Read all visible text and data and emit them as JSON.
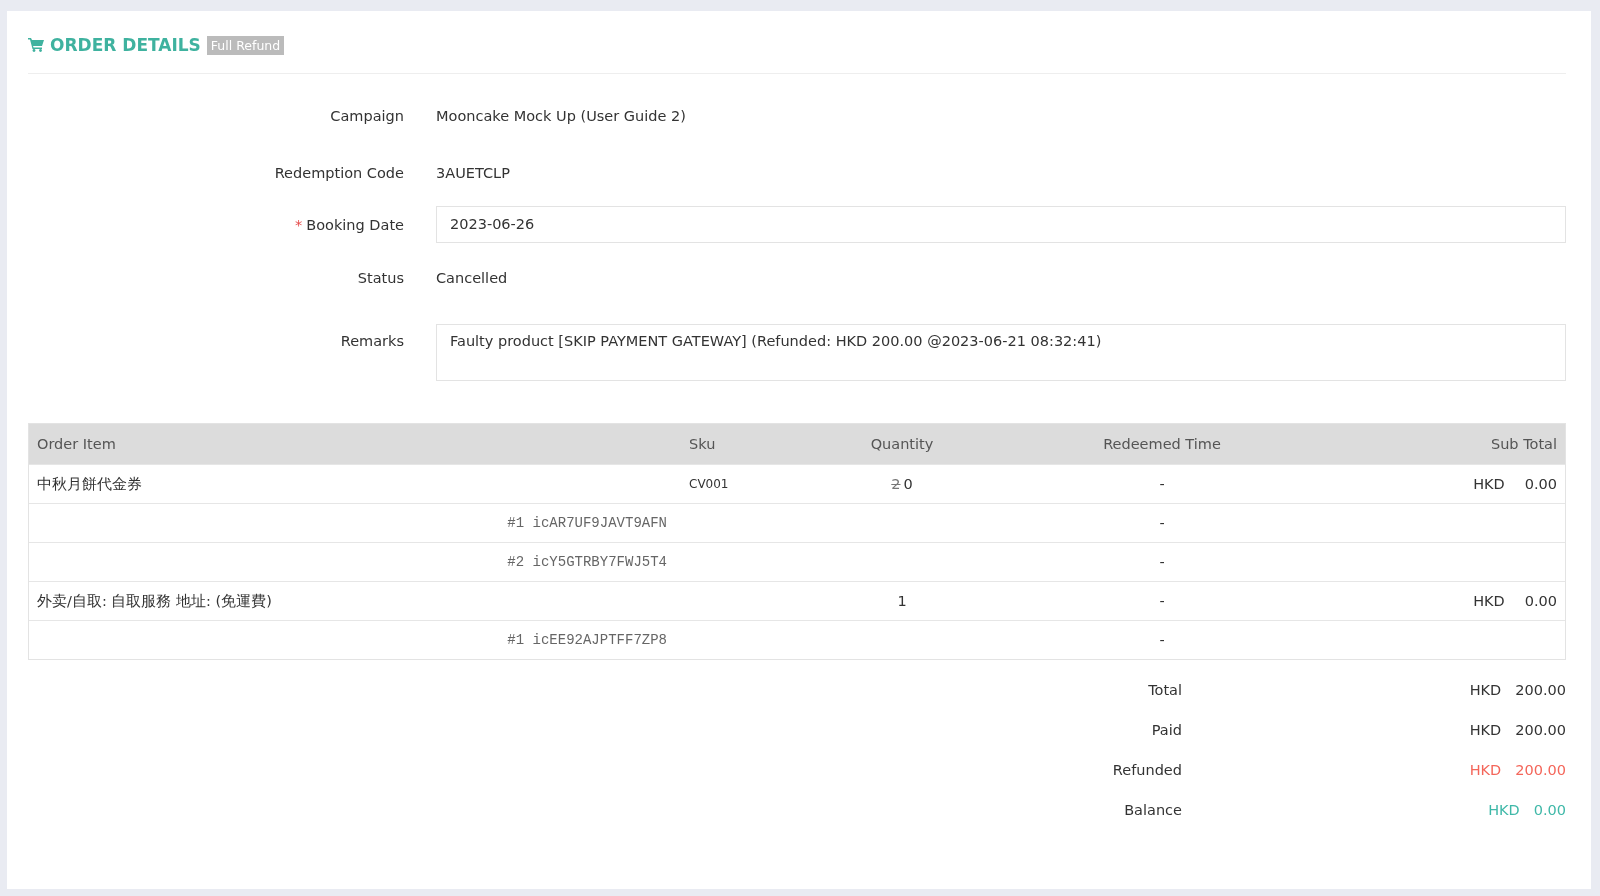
{
  "header": {
    "title": "ORDER DETAILS",
    "badge": "Full Refund"
  },
  "fields": [
    {
      "kind": "text",
      "label": "Campaign",
      "value": "Mooncake Mock Up (User Guide 2)"
    },
    {
      "kind": "text",
      "label": "Redemption Code",
      "value": "3AUETCLP"
    },
    {
      "kind": "input",
      "label": "Booking Date",
      "required_marker": "*",
      "value": "2023-06-26"
    },
    {
      "kind": "text",
      "label": "Status",
      "value": "Cancelled"
    },
    {
      "kind": "textarea",
      "label": "Remarks",
      "value": "Faulty product [SKIP PAYMENT GATEWAY] (Refunded: HKD 200.00 @2023-06-21 08:32:41)"
    }
  ],
  "table": {
    "columns": [
      "Order Item",
      "Sku",
      "Quantity",
      "Redeemed Time",
      "Sub Total"
    ],
    "rows": [
      {
        "kind": "item",
        "name": "中秋月餅代金券",
        "sku": "CV001",
        "old_quantity": "2",
        "quantity": "0",
        "redeemed": "-",
        "currency": "HKD",
        "amount": "0.00"
      },
      {
        "kind": "code",
        "code": "#1 icAR7UF9JAVT9AFN",
        "redeemed": "-"
      },
      {
        "kind": "code",
        "code": "#2 icY5GTRBY7FWJ5T4",
        "redeemed": "-"
      },
      {
        "kind": "item",
        "name": "外卖/自取: 自取服務 地址: (免運費)",
        "quantity": "1",
        "redeemed": "-",
        "currency": "HKD",
        "amount": "0.00"
      },
      {
        "kind": "code",
        "code": "#1 icEE92AJPTFF7ZP8",
        "redeemed": "-"
      }
    ]
  },
  "totals": [
    {
      "label": "Total",
      "currency": "HKD",
      "amount": "200.00",
      "color": "#333333"
    },
    {
      "label": "Paid",
      "currency": "HKD",
      "amount": "200.00",
      "color": "#333333"
    },
    {
      "label": "Refunded",
      "currency": "HKD",
      "amount": "200.00",
      "color": "#f4665a"
    },
    {
      "label": "Balance",
      "currency": "HKD",
      "amount": "0.00",
      "color": "#3fb8a8"
    }
  ]
}
